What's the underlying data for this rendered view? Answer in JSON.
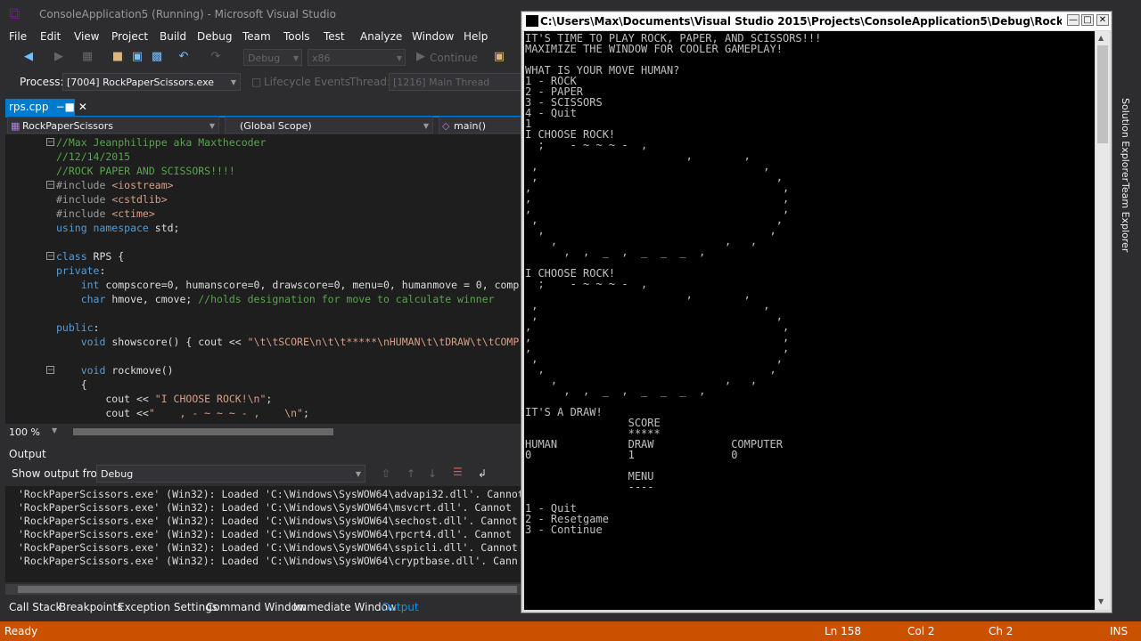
{
  "window": {
    "title": "ConsoleApplication5 (Running) - Microsoft Visual Studio"
  },
  "menu": [
    "File",
    "Edit",
    "View",
    "Project",
    "Build",
    "Debug",
    "Team",
    "Tools",
    "Test",
    "Analyze",
    "Window",
    "Help"
  ],
  "toolbar": {
    "config": "Debug",
    "platform": "x86",
    "continue_label": "Continue"
  },
  "process_bar": {
    "process_label": "Process:",
    "process_value": "[7004] RockPaperScissors.exe",
    "lifecycle_label": "Lifecycle Events",
    "thread_label": "Thread:",
    "thread_value": "[1216] Main Thread"
  },
  "editor": {
    "tab_label": "rps.cpp",
    "nav_project": "RockPaperScissors",
    "nav_scope": "(Global Scope)",
    "nav_member": "main()",
    "zoom": "100 %",
    "lines": [
      [
        {
          "t": "//Max Jeanphilippe aka Maxthecoder",
          "c": "c-com"
        }
      ],
      [
        {
          "t": "//12/14/2015",
          "c": "c-com"
        }
      ],
      [
        {
          "t": "//ROCK PAPER AND SCISSORS!!!!",
          "c": "c-com"
        }
      ],
      [
        {
          "t": "#include ",
          "c": "c-inc"
        },
        {
          "t": "<iostream>",
          "c": "c-hdr"
        }
      ],
      [
        {
          "t": "#include ",
          "c": "c-inc"
        },
        {
          "t": "<cstdlib>",
          "c": "c-hdr"
        }
      ],
      [
        {
          "t": "#include ",
          "c": "c-inc"
        },
        {
          "t": "<ctime>",
          "c": "c-hdr"
        }
      ],
      [
        {
          "t": "using namespace ",
          "c": "c-kw"
        },
        {
          "t": "std;",
          "c": ""
        }
      ],
      [
        {
          "t": "",
          "c": ""
        }
      ],
      [
        {
          "t": "class ",
          "c": "c-kw"
        },
        {
          "t": "RPS {",
          "c": ""
        }
      ],
      [
        {
          "t": "private",
          "c": "c-kw"
        },
        {
          "t": ":",
          "c": ""
        }
      ],
      [
        {
          "t": "    int ",
          "c": "c-kw"
        },
        {
          "t": "compscore=0, humanscore=0, drawscore=0, menu=0, humanmove = 0, comp",
          "c": ""
        }
      ],
      [
        {
          "t": "    char ",
          "c": "c-kw"
        },
        {
          "t": "hmove, cmove; ",
          "c": ""
        },
        {
          "t": "//holds designation for move to calculate winner",
          "c": "c-com"
        }
      ],
      [
        {
          "t": "",
          "c": ""
        }
      ],
      [
        {
          "t": "public",
          "c": "c-kw"
        },
        {
          "t": ":",
          "c": ""
        }
      ],
      [
        {
          "t": "    void ",
          "c": "c-kw"
        },
        {
          "t": "showscore() { cout << ",
          "c": ""
        },
        {
          "t": "\"\\t\\tSCORE\\n\\t\\t*****\\nHUMAN\\t\\tDRAW\\t\\tCOMP",
          "c": "c-str"
        }
      ],
      [
        {
          "t": "",
          "c": ""
        }
      ],
      [
        {
          "t": "    void ",
          "c": "c-kw"
        },
        {
          "t": "rockmove()",
          "c": ""
        }
      ],
      [
        {
          "t": "    {",
          "c": ""
        }
      ],
      [
        {
          "t": "        cout << ",
          "c": ""
        },
        {
          "t": "\"I CHOOSE ROCK!\\n\"",
          "c": "c-str"
        },
        {
          "t": ";",
          "c": ""
        }
      ],
      [
        {
          "t": "        cout <<",
          "c": ""
        },
        {
          "t": "\"    , - ~ ~ ~ - ,    \\n\"",
          "c": "c-str"
        },
        {
          "t": ";",
          "c": ""
        }
      ]
    ]
  },
  "output": {
    "title": "Output",
    "show_from_label": "Show output from:",
    "source": "Debug",
    "lines": [
      "'RockPaperScissors.exe' (Win32): Loaded 'C:\\Windows\\SysWOW64\\advapi32.dll'. Cannot",
      "'RockPaperScissors.exe' (Win32): Loaded 'C:\\Windows\\SysWOW64\\msvcrt.dll'. Cannot",
      "'RockPaperScissors.exe' (Win32): Loaded 'C:\\Windows\\SysWOW64\\sechost.dll'. Cannot",
      "'RockPaperScissors.exe' (Win32): Loaded 'C:\\Windows\\SysWOW64\\rpcrt4.dll'. Cannot",
      "'RockPaperScissors.exe' (Win32): Loaded 'C:\\Windows\\SysWOW64\\sspicli.dll'. Cannot",
      "'RockPaperScissors.exe' (Win32): Loaded 'C:\\Windows\\SysWOW64\\cryptbase.dll'. Cann"
    ]
  },
  "bottom_tabs": [
    "Call Stack",
    "Breakpoints",
    "Exception Settings",
    "Command Window",
    "Immediate Window",
    "Output"
  ],
  "status": {
    "ready": "Ready",
    "ln": "Ln 158",
    "col": "Col 2",
    "ch": "Ch 2",
    "ins": "INS"
  },
  "side_tabs": [
    "Solution Explorer",
    "Team Explorer"
  ],
  "console": {
    "title": "C:\\Users\\Max\\Documents\\Visual Studio 2015\\Projects\\ConsoleApplication5\\Debug\\RockPaperScisso...",
    "lines": [
      "IT'S TIME TO PLAY ROCK, PAPER, AND SCISSORS!!!",
      "MAXIMIZE THE WINDOW FOR COOLER GAMEPLAY!",
      "",
      "WHAT IS YOUR MOVE HUMAN?",
      "1 - ROCK",
      "2 - PAPER",
      "3 - SCISSORS",
      "4 - Quit",
      "1",
      "I CHOOSE ROCK!",
      "  ;    - ~ ~ ~ -  ,",
      "                         ,        ,",
      " ,                                   ,",
      " ,                                     ,",
      ",                                       ,",
      ",                                       ,",
      ",                                       ,",
      " ,                                     ,",
      "  ,                                   ,",
      "    ,                          ,   ,",
      "      ,  ,  _  ,  _  _  _  ,",
      "",
      "I CHOOSE ROCK!",
      "  ;    - ~ ~ ~ -  ,",
      "                         ,        ,",
      " ,                                   ,",
      " ,                                     ,",
      ",                                       ,",
      ",                                       ,",
      ",                                       ,",
      " ,                                     ,",
      "  ,                                   ,",
      "    ,                          ,   ,",
      "      ,  ,  _  ,  _  _  _  ,",
      "",
      "IT'S A DRAW!",
      "                SCORE",
      "                *****",
      "HUMAN           DRAW            COMPUTER",
      "0               1               0",
      "",
      "                MENU",
      "                ----",
      "",
      "1 - Quit",
      "2 - Resetgame",
      "3 - Continue"
    ]
  }
}
